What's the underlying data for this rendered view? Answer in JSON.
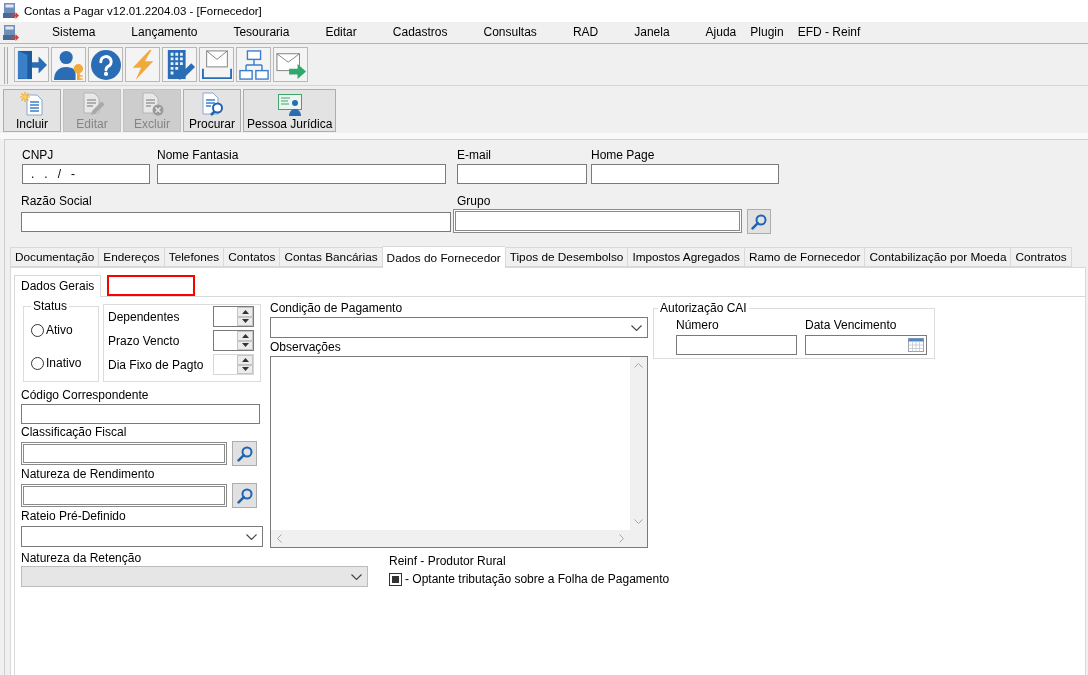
{
  "window": {
    "title": "Contas a Pagar v12.01.2204.03 - [Fornecedor]"
  },
  "menu": [
    "Sistema",
    "Lançamento",
    "Tesouraria",
    "Editar",
    "Cadastros",
    "Consultas",
    "RAD",
    "Janela",
    "Ajuda",
    "Plugin",
    "EFD - Reinf"
  ],
  "actions": [
    {
      "label": "Incluir",
      "disabled": false
    },
    {
      "label": "Editar",
      "disabled": true
    },
    {
      "label": "Excluir",
      "disabled": true
    },
    {
      "label": "Procurar",
      "disabled": false
    },
    {
      "label": "Pessoa Jurídica",
      "disabled": false
    }
  ],
  "header": {
    "cnpj": {
      "label": "CNPJ",
      "value": ".   .   /   -"
    },
    "nome_fantasia": {
      "label": "Nome Fantasia"
    },
    "email": {
      "label": "E-mail"
    },
    "home_page": {
      "label": "Home Page"
    },
    "razao_social": {
      "label": "Razão Social"
    },
    "grupo": {
      "label": "Grupo"
    }
  },
  "tabs": [
    {
      "label": "Documentação",
      "selected": false
    },
    {
      "label": "Endereços",
      "selected": false
    },
    {
      "label": "Telefones",
      "selected": false
    },
    {
      "label": "Contatos",
      "selected": false
    },
    {
      "label": "Contas Bancárias",
      "selected": false
    },
    {
      "label": "Dados do Fornecedor",
      "selected": true
    },
    {
      "label": "Tipos de Desembolso",
      "selected": false
    },
    {
      "label": "Impostos Agregados",
      "selected": false
    },
    {
      "label": "Ramo de Fornecedor",
      "selected": false
    },
    {
      "label": "Contabilização por Moeda",
      "selected": false
    },
    {
      "label": "Contratos",
      "selected": false
    }
  ],
  "sub_tabs": [
    {
      "label": "Dados Gerais",
      "selected": true
    }
  ],
  "highlight_frame": true,
  "general": {
    "status": {
      "title": "Status",
      "options": [
        {
          "label": "Ativo",
          "selected": false
        },
        {
          "label": "Inativo",
          "selected": false
        }
      ]
    },
    "spinners": [
      {
        "label": "Dependentes",
        "disabled": false
      },
      {
        "label": "Prazo Vencto",
        "disabled": false
      },
      {
        "label": "Dia Fixo de Pagto",
        "disabled": true
      }
    ],
    "fields": [
      {
        "label": "Código Correspondente",
        "kind": "text"
      },
      {
        "label": "Classificação Fiscal",
        "kind": "lookup"
      },
      {
        "label": "Natureza de Rendimento",
        "kind": "lookup"
      },
      {
        "label": "Rateio Pré-Definido",
        "kind": "combo"
      }
    ],
    "payment_condition": {
      "label": "Condição de Pagamento"
    },
    "notes": {
      "label": "Observações"
    },
    "retention": {
      "label": "Natureza da Retenção",
      "disabled": true
    },
    "reinf": {
      "title": "Reinf - Produtor Rural",
      "option": {
        "label": "- Optante tributação sobre a Folha de Pagamento",
        "indeterminate": true
      }
    },
    "cai": {
      "title": "Autorização CAI",
      "number": {
        "label": "Número"
      },
      "due_date": {
        "label": "Data Vencimento"
      }
    }
  }
}
